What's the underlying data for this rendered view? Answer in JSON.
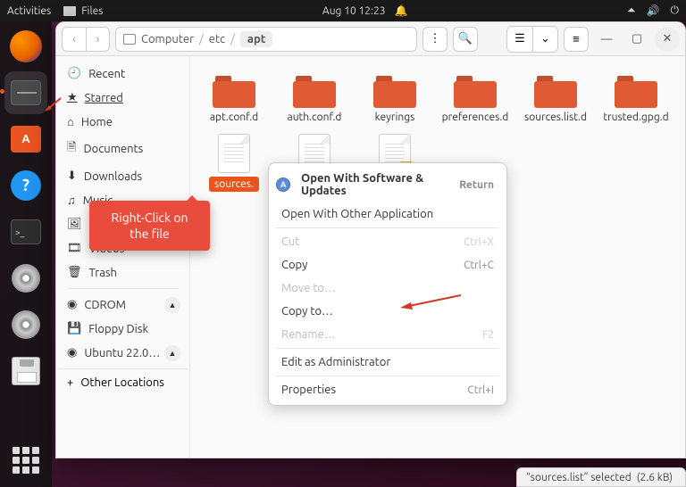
{
  "topbar": {
    "activities": "Activities",
    "files_label": "Files",
    "datetime": "Aug 10  12:23"
  },
  "toolbar": {
    "breadcrumb": {
      "root": "Computer",
      "p1": "etc",
      "p2": "apt"
    }
  },
  "sidebar": {
    "items": [
      {
        "label": "Recent"
      },
      {
        "label": "Starred"
      },
      {
        "label": "Home"
      },
      {
        "label": "Documents"
      },
      {
        "label": "Downloads"
      },
      {
        "label": "Music"
      },
      {
        "label": "Pictures"
      },
      {
        "label": "Videos"
      },
      {
        "label": "Trash"
      },
      {
        "label": "CDROM"
      },
      {
        "label": "Floppy Disk"
      },
      {
        "label": "Ubuntu 22.0…"
      }
    ],
    "other": "Other Locations"
  },
  "files": {
    "row1": [
      {
        "name": "apt.conf.d"
      },
      {
        "name": "auth.conf.d"
      },
      {
        "name": "keyrings"
      },
      {
        "name": "preferences.d"
      },
      {
        "name": "sources.list.d"
      },
      {
        "name": "trusted.gpg.d"
      }
    ],
    "row2_label": "sources."
  },
  "ctx": {
    "open_software": "Open With Software & Updates",
    "open_software_sc": "Return",
    "open_other": "Open With Other Application",
    "cut": "Cut",
    "cut_sc": "Ctrl+X",
    "copy": "Copy",
    "copy_sc": "Ctrl+C",
    "move_to": "Move to…",
    "copy_to": "Copy to…",
    "rename": "Rename…",
    "rename_sc": "F2",
    "edit_admin": "Edit as Administrator",
    "properties": "Properties",
    "properties_sc": "Ctrl+I"
  },
  "callout": {
    "line1": "Right-Click on",
    "line2": "the file"
  },
  "status": {
    "text": "“sources.list” selected",
    "size": "(2.6 kB)"
  }
}
